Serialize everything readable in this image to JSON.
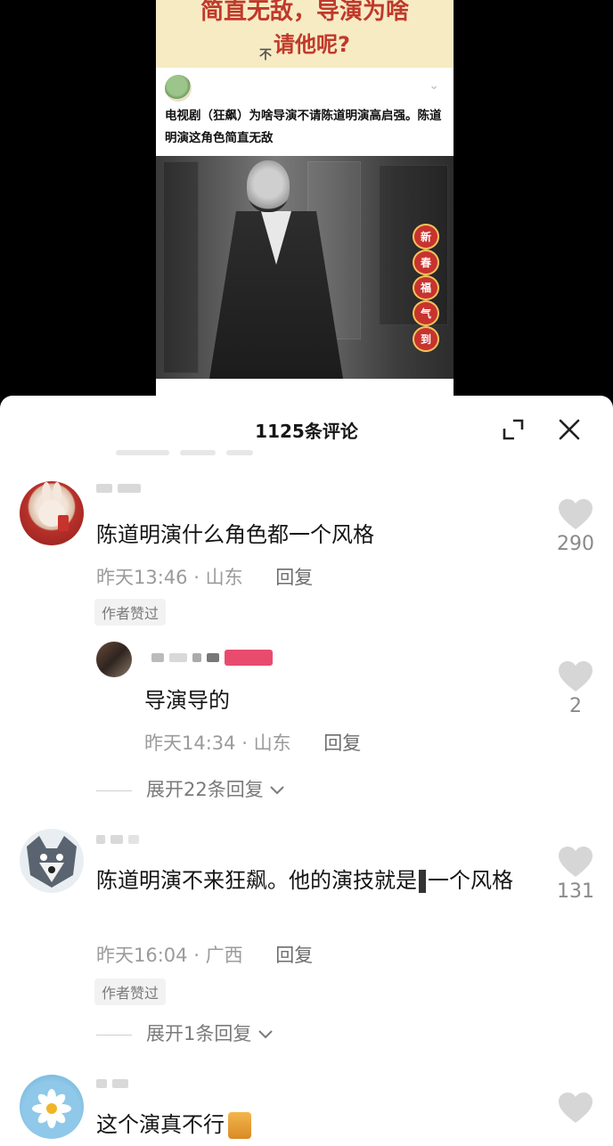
{
  "post": {
    "banner_line1": "简直无敌，导演为啥",
    "banner_line2": "请他呢?",
    "banner_prefix": "不",
    "title": "电视剧（狂飙）为啥导演不请陈道明演高启强。陈道明演这角色简直无敌",
    "sticker_chars": [
      "新",
      "春",
      "福",
      "气",
      "到"
    ]
  },
  "sheet": {
    "title": "1125条评论",
    "expand_icon": "expand-icon",
    "close_icon": "close-icon"
  },
  "comments": [
    {
      "text": "陈道明演什么角色都一个风格",
      "time": "昨天13:46",
      "location": "山东",
      "reply_label": "回复",
      "badge": "作者赞过",
      "likes": "290",
      "avatar": "rabbit-avatar"
    },
    {
      "text": "导演导的",
      "time": "昨天14:34",
      "location": "山东",
      "reply_label": "回复",
      "likes": "2",
      "avatar": "photo-avatar",
      "expand": "展开22条回复"
    },
    {
      "text_part1": "陈道明演不来狂飙。他的演技就是",
      "text_part2": "一个风格",
      "time": "昨天16:04",
      "location": "广西",
      "reply_label": "回复",
      "badge": "作者赞过",
      "likes": "131",
      "avatar": "wolf-avatar",
      "expand": "展开1条回复"
    },
    {
      "text": "这个演真不行",
      "avatar": "flower-avatar"
    }
  ],
  "colors": {
    "banner_bg": "#f7ebc4",
    "banner_text": "#c0392b",
    "like_heart": "#d6d6d6",
    "meta_text": "#9b9b9b"
  }
}
